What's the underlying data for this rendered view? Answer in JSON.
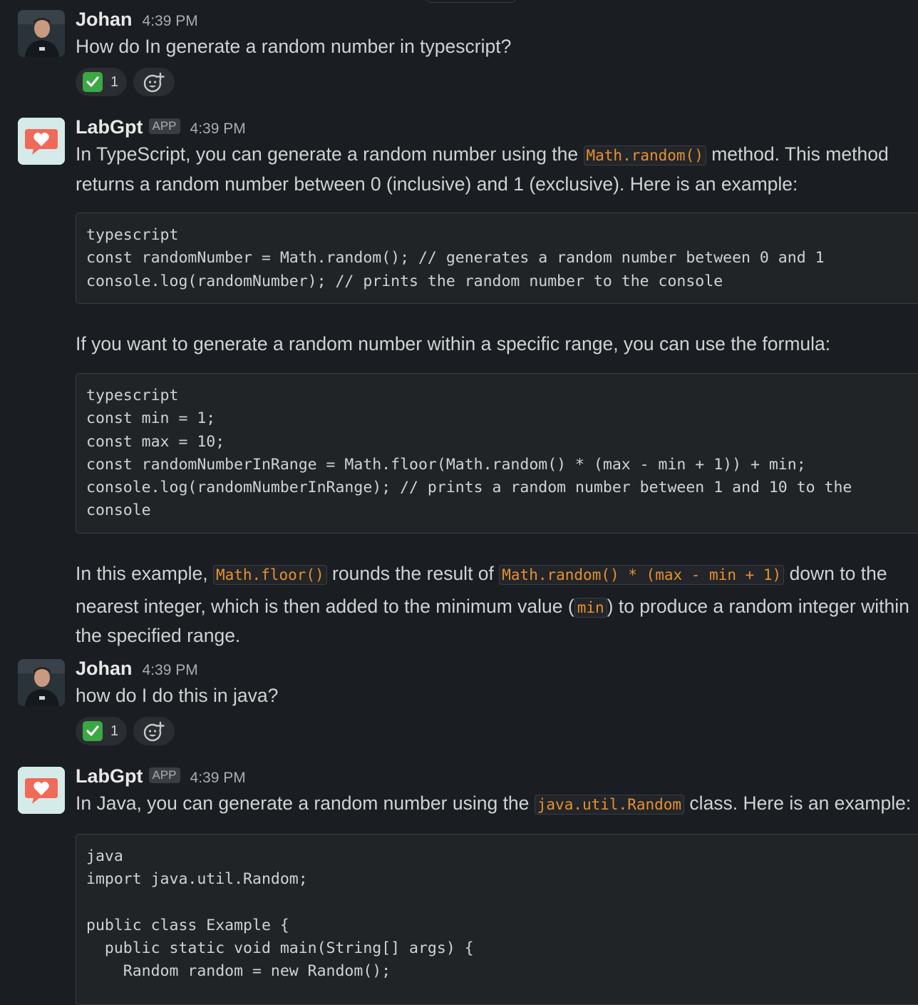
{
  "messages": [
    {
      "author": "Johan",
      "time": "4:39 PM",
      "text": "How do In generate a random number in typescript?",
      "reaction_count": "1"
    },
    {
      "author": "LabGpt",
      "badge": "APP",
      "time": "4:39 PM",
      "intro_line1_pre": "In TypeScript, you can generate a random number using the ",
      "intro_line1_code": "Math.random()",
      "intro_line1_post": " method. This method",
      "intro_line2": "returns a random number between 0 (inclusive) and 1 (exclusive). Here is an example:",
      "code1": [
        "typescript",
        "const randomNumber = Math.random(); // generates a random number between 0 and 1",
        "console.log(randomNumber); // prints the random number to the console"
      ],
      "mid_text": "If you want to generate a random number within a specific range, you can use the formula:",
      "code2": [
        "typescript",
        "const min = 1;",
        "const max = 10;",
        "const randomNumberInRange = Math.floor(Math.random() * (max - min + 1)) + min;",
        "console.log(randomNumberInRange); // prints a random number between 1 and 10 to the",
        "console"
      ],
      "outro_l1_a": "In this example, ",
      "outro_l1_code1": "Math.floor()",
      "outro_l1_b": " rounds the result of ",
      "outro_l1_code2": "Math.random() * (max - min + 1)",
      "outro_l1_c": " down to the",
      "outro_l2_a": "nearest integer, which is then added to the minimum value (",
      "outro_l2_code": "min",
      "outro_l2_b": ") to produce a random integer within",
      "outro_l3": "the specified range."
    },
    {
      "author": "Johan",
      "time": "4:39 PM",
      "text": "how do I do this in java?",
      "reaction_count": "1"
    },
    {
      "author": "LabGpt",
      "badge": "APP",
      "time": "4:39 PM",
      "intro_pre": "In Java, you can generate a random number using the ",
      "intro_code": "java.util.Random",
      "intro_post": " class. Here is an example:",
      "code": [
        "java",
        "import java.util.Random;",
        "",
        "public class Example {",
        "  public static void main(String[] args) {",
        "    Random random = new Random();"
      ]
    }
  ],
  "icons": {
    "reaction": "white-check-mark-icon",
    "add_reaction": "add-reaction-icon",
    "bot_avatar": "heart-speech-bubble-icon"
  },
  "colors": {
    "background": "#1a1d21",
    "inline_code": "#e8912d",
    "check": "#3ba844",
    "bot_avatar_bg": "#d5ebea",
    "heart_bubble": "#f06a59"
  }
}
